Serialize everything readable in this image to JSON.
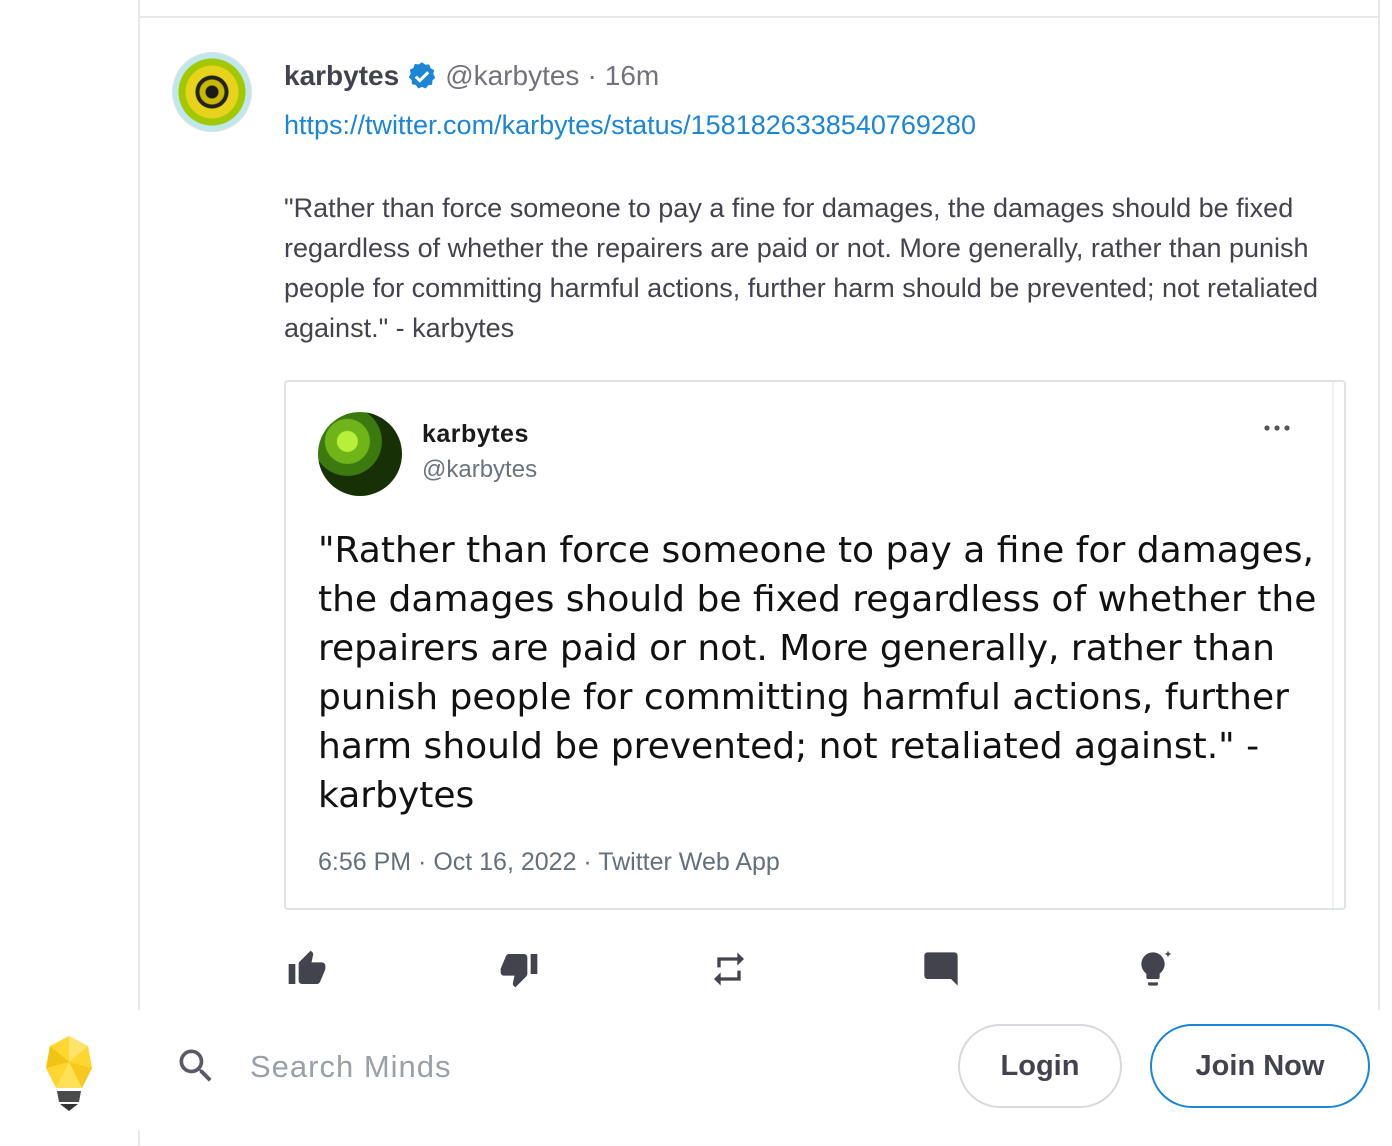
{
  "post": {
    "author_name": "karbytes",
    "author_handle": "@karbytes",
    "separator": "·",
    "time_ago": "16m",
    "link": "https://twitter.com/karbytes/status/1581826338540769280",
    "text": "\"Rather than force someone to pay a fine for damages, the damages should be fixed regardless of whether the repairers are paid or not. More generally, rather than punish people for committing harmful actions, further harm should be prevented; not retaliated against.\" - karbytes"
  },
  "embed": {
    "name": "karbytes",
    "handle": "@karbytes",
    "text": "\"Rather than force someone to pay a fine for damages, the damages should be fixed regardless of whether the repairers are paid or not. More generally, rather than punish people for committing harmful actions, further harm should be prevented; not retaliated against.\" - karbytes",
    "meta": "6:56 PM · Oct 16, 2022 · Twitter Web App"
  },
  "actions": [
    {
      "icon": "thumb-up-icon"
    },
    {
      "icon": "thumb-down-icon"
    },
    {
      "icon": "remind-icon"
    },
    {
      "icon": "comment-icon"
    },
    {
      "icon": "boost-icon"
    }
  ],
  "bottom_bar": {
    "search_placeholder": "Search Minds",
    "login_label": "Login",
    "join_label": "Join Now"
  },
  "colors": {
    "link": "#1b85d6",
    "verified": "#1b85d6",
    "text": "#43434d",
    "muted": "#72727c"
  }
}
